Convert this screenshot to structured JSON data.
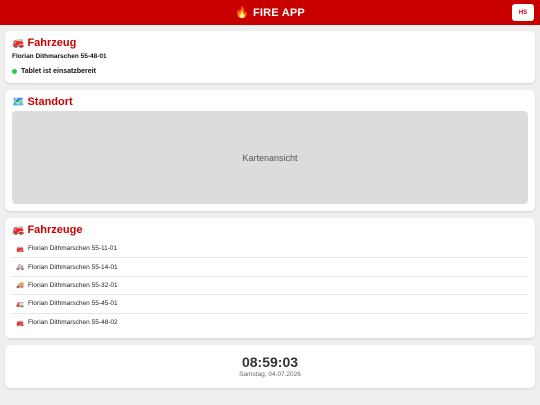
{
  "header": {
    "title": "FIRE APP",
    "flame_icon": "🔥",
    "avatar_initials": "HS",
    "color": "#c80000"
  },
  "vehicle_card": {
    "icon": "🚒",
    "title": "Fahrzeug",
    "vehicle_name": "Florian Dithmarschen 55-48-01",
    "status_text": "Tablet ist einsatzbereit",
    "status_color": "#2ec84a"
  },
  "location_card": {
    "icon": "🗺️",
    "title": "Standort",
    "map_placeholder": "Kartenansicht"
  },
  "fleet_card": {
    "icon": "🚒",
    "title": "Fahrzeuge",
    "items": [
      {
        "icon": "🚒",
        "label": "Florian Dithmarschen 55-11-01"
      },
      {
        "icon": "🚑",
        "label": "Florian Dithmarschen 55-14-01"
      },
      {
        "icon": "🚚",
        "label": "Florian Dithmarschen 55-32-01"
      },
      {
        "icon": "🚛",
        "label": "Florian Dithmarschen 55-45-01"
      },
      {
        "icon": "🚒",
        "label": "Florian Dithmarschen 55-48-02"
      }
    ]
  },
  "clock_card": {
    "time": "08:59:03",
    "date": "Samstag, 04.07.2026"
  }
}
